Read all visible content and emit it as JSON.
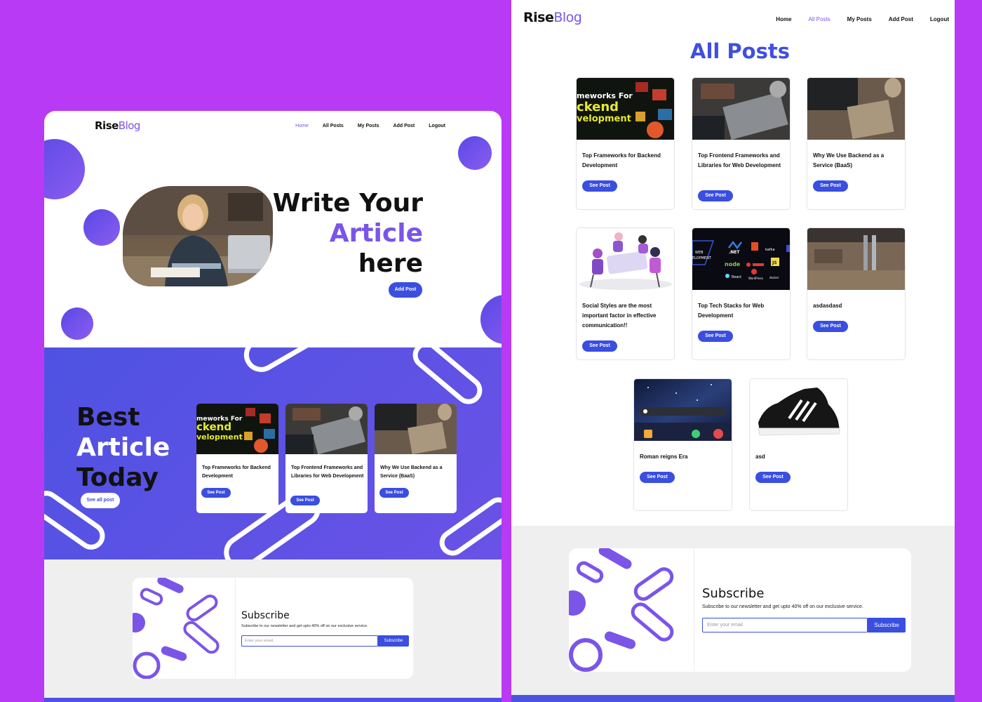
{
  "brand": {
    "rise": "Rise",
    "blog": "Blog"
  },
  "left": {
    "nav": [
      "Home",
      "All Posts",
      "My Posts",
      "Add Post",
      "Logout"
    ],
    "hero": {
      "line1": "Write Your",
      "line2": "Article",
      "line3": "here",
      "button": "Add Post"
    },
    "best": {
      "line1": "Best",
      "line2": "Article",
      "line3": "Today",
      "button": "See all post"
    },
    "cards": [
      {
        "title": "Top Frameworks for Backend Development",
        "button": "See Post"
      },
      {
        "title": "Top Frontend Frameworks and Libraries for Web Development",
        "button": "See Post"
      },
      {
        "title": "Why We Use Backend as a Service (BaaS)",
        "button": "See Post"
      }
    ],
    "subscribe": {
      "title": "Subscribe",
      "text": "Subscribe to our newsletter and get upto 40% off on our exclusive service.",
      "placeholder": "Enter your email",
      "button": "Subscribe"
    }
  },
  "right": {
    "nav": [
      "Home",
      "All Posts",
      "My Posts",
      "Add Post",
      "Logout"
    ],
    "heading": "All Posts",
    "cards": [
      {
        "title": "Top Frameworks for Backend Development",
        "button": "See Post"
      },
      {
        "title": "Top Frontend Frameworks and Libraries for Web Development",
        "button": "See Post"
      },
      {
        "title": "Why We Use Backend as a Service (BaaS)",
        "button": "See Post"
      },
      {
        "title": "Social Styles are the most important factor in effective communication!!",
        "button": "See Post"
      },
      {
        "title": "Top Tech Stacks for Web Development",
        "button": "See Post"
      },
      {
        "title": "asdasdasd",
        "button": "See Post"
      },
      {
        "title": "Roman reigns Era",
        "button": "See Post"
      },
      {
        "title": "asd",
        "button": "See Post"
      }
    ],
    "subscribe": {
      "title": "Subscribe",
      "text": "Subscribe to our newsletter and get upto 40% off on our exclusive service.",
      "placeholder": "Enter your email",
      "button": "Subscribe"
    }
  },
  "thumb_text": {
    "backend_l1": "meworks For",
    "backend_l2": "ckend",
    "backend_l3": "velopment",
    "tech_web": "WEB",
    "tech_dev": "ELOPMENT",
    "tech_net": ".NET",
    "tech_kafka": "kafka",
    "tech_node": "node",
    "tech_react": "React",
    "tech_wp": "WordPress",
    "tech_docker": "docker",
    "tech_js": "JS"
  },
  "colors": {
    "background": "#b93af5",
    "accent": "#7a55e8",
    "button": "#3a4ee0",
    "band": "#5c4fe4",
    "footer_bg": "#efefef"
  }
}
